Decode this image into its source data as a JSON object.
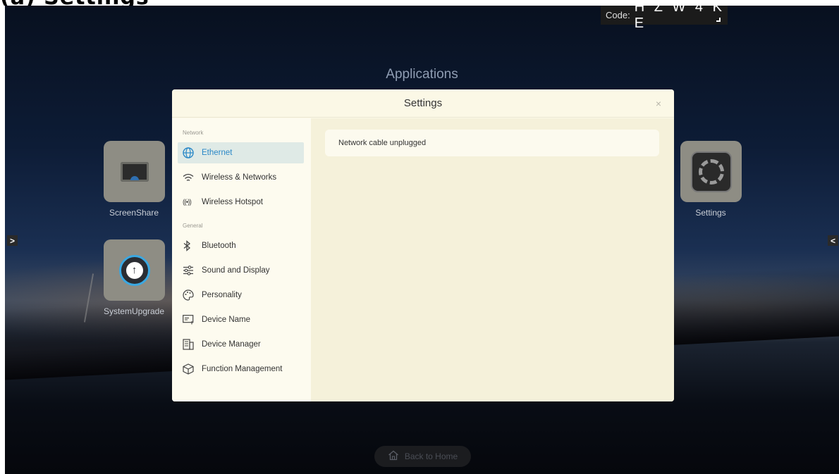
{
  "header": {
    "top_label": "(a) Settings"
  },
  "code": {
    "label": "Code:",
    "value": "H Z W 4 K E"
  },
  "launcher": {
    "title": "Applications",
    "apps": [
      {
        "label": "ScreenShare",
        "icon": "screenshare-icon"
      },
      {
        "label": "SystemUpgrade",
        "icon": "upload-icon"
      },
      {
        "label": "Settings",
        "icon": "gear-icon"
      }
    ],
    "left_arrow": ">",
    "right_arrow": "<",
    "home_button": "Back to Home"
  },
  "settings": {
    "title": "Settings",
    "close": "×",
    "sections": [
      {
        "label": "Network",
        "items": [
          {
            "label": "Ethernet",
            "icon": "globe-icon",
            "active": true
          },
          {
            "label": "Wireless & Networks",
            "icon": "wifi-icon"
          },
          {
            "label": "Wireless Hotspot",
            "icon": "hotspot-icon"
          }
        ]
      },
      {
        "label": "General",
        "items": [
          {
            "label": "Bluetooth",
            "icon": "bluetooth-icon"
          },
          {
            "label": "Sound and Display",
            "icon": "sliders-icon"
          },
          {
            "label": "Personality",
            "icon": "palette-icon"
          },
          {
            "label": "Device Name",
            "icon": "device-name-icon"
          },
          {
            "label": "Device Manager",
            "icon": "device-manager-icon"
          },
          {
            "label": "Function Management",
            "icon": "cube-icon"
          }
        ]
      }
    ],
    "status_message": "Network cable unplugged"
  },
  "colors": {
    "accent": "#2a88c7",
    "active_bg": "#dfeae6",
    "modal_bg": "#fbf8e8"
  }
}
